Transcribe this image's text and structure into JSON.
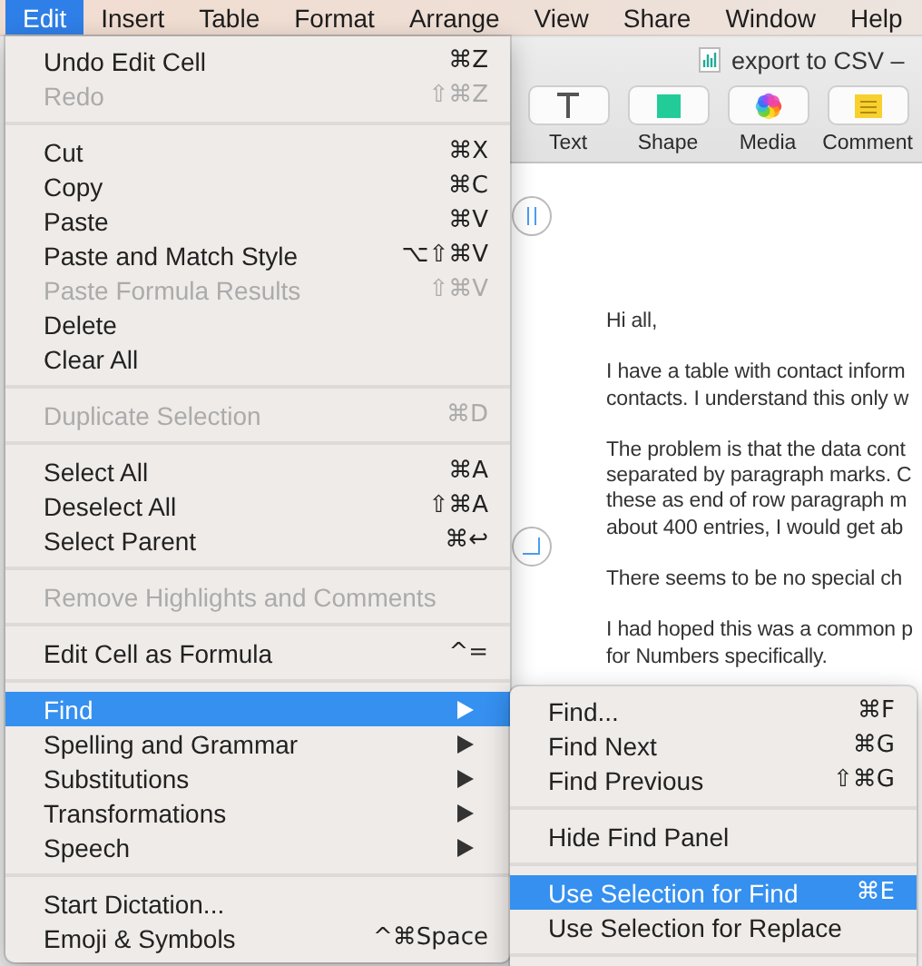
{
  "menubar": {
    "items": [
      {
        "label": "Edit",
        "selected": true
      },
      {
        "label": "Insert",
        "selected": false
      },
      {
        "label": "Table",
        "selected": false
      },
      {
        "label": "Format",
        "selected": false
      },
      {
        "label": "Arrange",
        "selected": false
      },
      {
        "label": "View",
        "selected": false
      },
      {
        "label": "Share",
        "selected": false
      },
      {
        "label": "Window",
        "selected": false
      },
      {
        "label": "Help",
        "selected": false
      }
    ]
  },
  "window": {
    "title": "export to CSV –",
    "toolbar": [
      {
        "label": "Text",
        "kind": "text"
      },
      {
        "label": "Shape",
        "kind": "shape"
      },
      {
        "label": "Media",
        "kind": "media"
      },
      {
        "label": "Comment",
        "kind": "comment"
      }
    ]
  },
  "document": {
    "paragraphs": [
      [
        "Hi all,"
      ],
      [
        "I have a table with contact inform",
        "contacts. I understand this only w"
      ],
      [
        "The problem is that the data cont",
        "separated by paragraph marks. C",
        "these as end of row paragraph m",
        "about 400 entries, I would get ab"
      ],
      [
        "There seems to be no special ch"
      ],
      [
        "I had hoped this was a common p",
        "for Numbers specifically."
      ]
    ]
  },
  "edit_menu": {
    "items": [
      {
        "kind": "item",
        "label": "Undo Edit Cell",
        "shortcut": "⌘Z",
        "disabled": false,
        "selected": false,
        "submenu": false
      },
      {
        "kind": "item",
        "label": "Redo",
        "shortcut": "⇧⌘Z",
        "disabled": true,
        "selected": false,
        "submenu": false
      },
      {
        "kind": "separator"
      },
      {
        "kind": "item",
        "label": "Cut",
        "shortcut": "⌘X",
        "disabled": false,
        "selected": false,
        "submenu": false
      },
      {
        "kind": "item",
        "label": "Copy",
        "shortcut": "⌘C",
        "disabled": false,
        "selected": false,
        "submenu": false
      },
      {
        "kind": "item",
        "label": "Paste",
        "shortcut": "⌘V",
        "disabled": false,
        "selected": false,
        "submenu": false
      },
      {
        "kind": "item",
        "label": "Paste and Match Style",
        "shortcut": "⌥⇧⌘V",
        "disabled": false,
        "selected": false,
        "submenu": false
      },
      {
        "kind": "item",
        "label": "Paste Formula Results",
        "shortcut": "⇧⌘V",
        "disabled": true,
        "selected": false,
        "submenu": false
      },
      {
        "kind": "item",
        "label": "Delete",
        "disabled": false,
        "selected": false,
        "submenu": false
      },
      {
        "kind": "item",
        "label": "Clear All",
        "disabled": false,
        "selected": false,
        "submenu": false
      },
      {
        "kind": "separator"
      },
      {
        "kind": "item",
        "label": "Duplicate Selection",
        "shortcut": "⌘D",
        "disabled": true,
        "selected": false,
        "submenu": false
      },
      {
        "kind": "separator"
      },
      {
        "kind": "item",
        "label": "Select All",
        "shortcut": "⌘A",
        "disabled": false,
        "selected": false,
        "submenu": false
      },
      {
        "kind": "item",
        "label": "Deselect All",
        "shortcut": "⇧⌘A",
        "disabled": false,
        "selected": false,
        "submenu": false
      },
      {
        "kind": "item",
        "label": "Select Parent",
        "shortcut": "⌘↩",
        "disabled": false,
        "selected": false,
        "submenu": false
      },
      {
        "kind": "separator"
      },
      {
        "kind": "item",
        "label": "Remove Highlights and Comments",
        "disabled": true,
        "selected": false,
        "submenu": false
      },
      {
        "kind": "separator"
      },
      {
        "kind": "item",
        "label": "Edit Cell as Formula",
        "shortcut": "^=",
        "disabled": false,
        "selected": false,
        "submenu": false
      },
      {
        "kind": "separator"
      },
      {
        "kind": "item",
        "label": "Find",
        "disabled": false,
        "selected": true,
        "submenu": true
      },
      {
        "kind": "item",
        "label": "Spelling and Grammar",
        "disabled": false,
        "selected": false,
        "submenu": true
      },
      {
        "kind": "item",
        "label": "Substitutions",
        "disabled": false,
        "selected": false,
        "submenu": true
      },
      {
        "kind": "item",
        "label": "Transformations",
        "disabled": false,
        "selected": false,
        "submenu": true
      },
      {
        "kind": "item",
        "label": "Speech",
        "disabled": false,
        "selected": false,
        "submenu": true
      },
      {
        "kind": "separator"
      },
      {
        "kind": "item",
        "label": "Start Dictation...",
        "disabled": false,
        "selected": false,
        "submenu": false
      },
      {
        "kind": "item",
        "label": "Emoji & Symbols",
        "shortcut": "^⌘Space",
        "disabled": false,
        "selected": false,
        "submenu": false
      }
    ]
  },
  "find_submenu": {
    "items": [
      {
        "kind": "item",
        "label": "Find...",
        "shortcut": "⌘F",
        "disabled": false,
        "selected": false,
        "submenu": false
      },
      {
        "kind": "item",
        "label": "Find Next",
        "shortcut": "⌘G",
        "disabled": false,
        "selected": false,
        "submenu": false
      },
      {
        "kind": "item",
        "label": "Find Previous",
        "shortcut": "⇧⌘G",
        "disabled": false,
        "selected": false,
        "submenu": false
      },
      {
        "kind": "separator"
      },
      {
        "kind": "item",
        "label": "Hide Find Panel",
        "disabled": false,
        "selected": false,
        "submenu": false
      },
      {
        "kind": "separator"
      },
      {
        "kind": "item",
        "label": "Use Selection for Find",
        "shortcut": "⌘E",
        "disabled": false,
        "selected": true,
        "submenu": false
      },
      {
        "kind": "item",
        "label": "Use Selection for Replace",
        "disabled": false,
        "selected": false,
        "submenu": false
      },
      {
        "kind": "separator"
      }
    ]
  }
}
